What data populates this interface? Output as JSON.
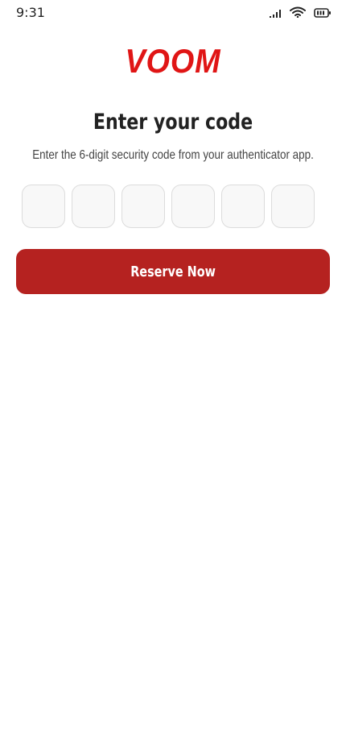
{
  "status_bar": {
    "time": "9:31",
    "icons": [
      "cellular-signal-icon",
      "wifi-icon",
      "battery-icon"
    ]
  },
  "brand": {
    "logo_text": "VOOM",
    "accent_color": "#e01515"
  },
  "verify": {
    "title": "Enter your code",
    "subtitle": "Enter the 6-digit security code from your authenticator app.",
    "code_length": 6,
    "code_digits": [
      "",
      "",
      "",
      "",
      "",
      ""
    ]
  },
  "actions": {
    "primary_label": "Reserve Now",
    "primary_color": "#b52220"
  }
}
